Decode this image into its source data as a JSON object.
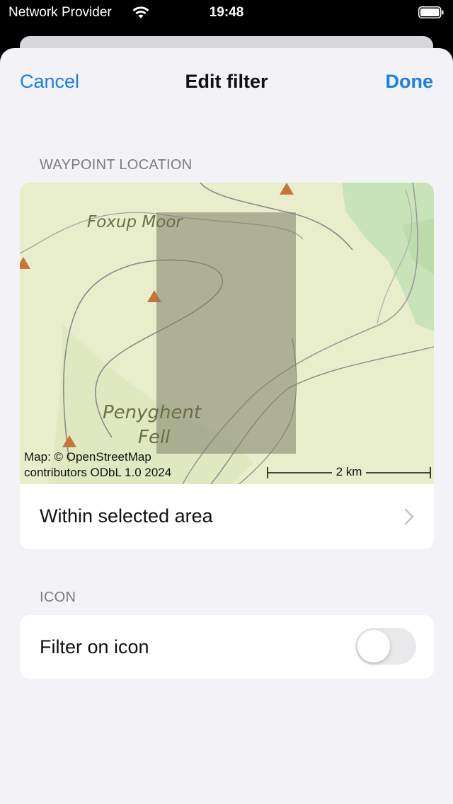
{
  "status_bar": {
    "carrier": "Network Provider",
    "time": "19:48",
    "icons": [
      "wifi-icon",
      "battery-icon"
    ]
  },
  "nav": {
    "cancel_label": "Cancel",
    "title": "Edit filter",
    "done_label": "Done"
  },
  "waypoint_location": {
    "header": "WAYPOINT LOCATION",
    "map": {
      "labels": [
        "Foxup Moor",
        "Penyghent",
        "Fell"
      ],
      "attribution_line1": "Map: © OpenStreetMap",
      "attribution_line2": "contributors ODbL 1.0 2024",
      "scale": "2 km"
    },
    "row_label": "Within selected area"
  },
  "icon_section": {
    "header": "ICON",
    "row_label": "Filter on icon",
    "toggle_on": false
  },
  "colors": {
    "accent": "#1a7fe6",
    "background": "#f2f2f7",
    "map_land": "#e8eecb",
    "map_peak": "#c8743a",
    "selection": "#8a8a74"
  }
}
